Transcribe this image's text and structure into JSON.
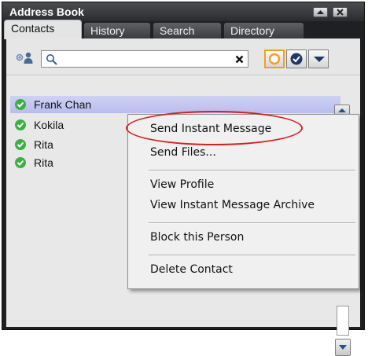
{
  "window": {
    "title": "Address Book"
  },
  "tabs": [
    {
      "label": "Contacts",
      "active": true
    },
    {
      "label": "History",
      "active": false
    },
    {
      "label": "Search",
      "active": false
    },
    {
      "label": "Directory",
      "active": false
    }
  ],
  "search": {
    "value": "",
    "placeholder": ""
  },
  "contacts": [
    {
      "name": "Frank Chan",
      "status": "online"
    },
    {
      "name": "Kokila",
      "status": "online"
    },
    {
      "name": "Rita",
      "status": "online"
    },
    {
      "name": "Rita",
      "status": "online"
    }
  ],
  "context_menu": {
    "items": [
      {
        "label": "Send Instant Message"
      },
      {
        "label": "Send Files..."
      },
      {
        "label": "View Profile"
      },
      {
        "label": "View Instant Message Archive"
      },
      {
        "label": "Block this Person"
      },
      {
        "label": "Delete Contact"
      }
    ]
  },
  "colors": {
    "titlebar": "#2e2f33",
    "selection": "#c4c8f1",
    "status_online": "#3cb043",
    "highlight_ring": "#d42020",
    "accent_orange": "#f0a020"
  },
  "icons": {
    "add_contact": "add-contact-icon",
    "search": "search-icon",
    "clear": "clear-icon",
    "status_available": "available-status-icon",
    "status_check": "check-status-icon",
    "dropdown": "dropdown-icon"
  }
}
